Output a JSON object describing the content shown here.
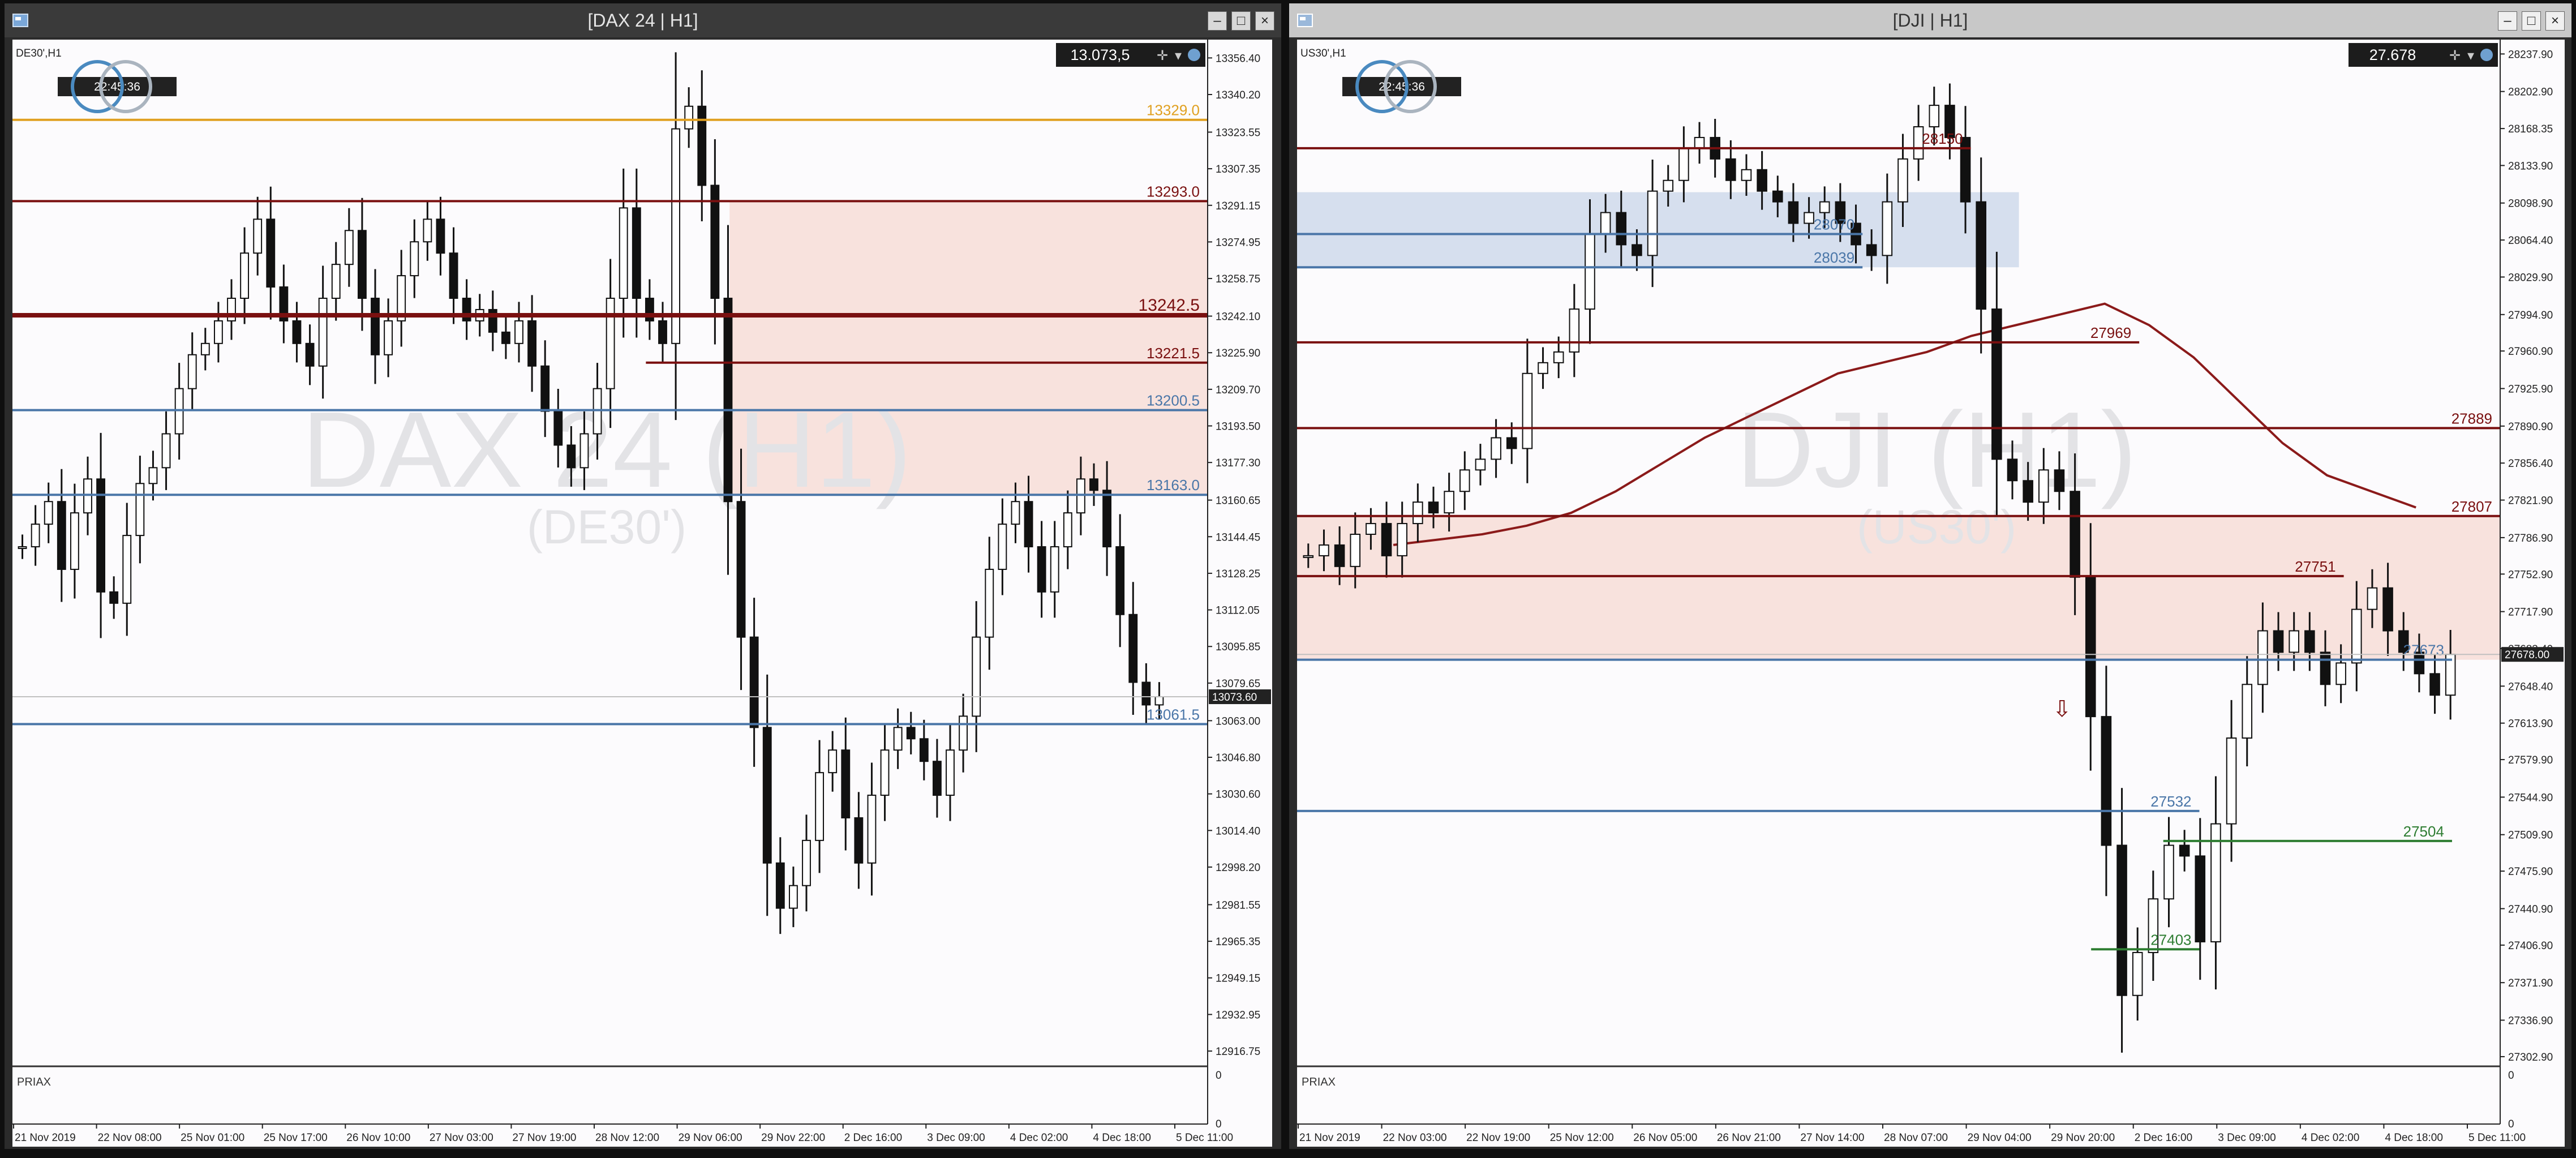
{
  "windows": [
    {
      "title": "[DAX 24 | H1]",
      "symbol_label": "DE30',H1",
      "clock": "22:45:36",
      "price_box": "13.073,5",
      "watermark_main": "DAX 24 (H1)",
      "watermark_sub": "(DE30')",
      "indicator_label": "PRIAX",
      "indicator_scale": [
        "0",
        "0"
      ],
      "current_price_tag": "13073.60"
    },
    {
      "title": "[DJI | H1]",
      "symbol_label": "US30',H1",
      "clock": "22:45:36",
      "price_box": "27.678",
      "watermark_main": "DJI (H1)",
      "watermark_sub": "(US30')",
      "indicator_label": "PRIAX",
      "indicator_scale": [
        "0",
        "0"
      ],
      "current_price_tag": "27678.00"
    }
  ],
  "colors": {
    "chart_bg": "#fcfbfd",
    "resistance": "#7a1010",
    "support": "#4a76a8",
    "support_green": "#2e7d32",
    "highlight_orange": "#e0a020",
    "zone_red": "#f7d9d2",
    "zone_blue": "#c9d6e8",
    "ma_line": "#8b1a1a"
  },
  "chart_data": [
    {
      "type": "candlestick",
      "symbol": "DAX 24 (DE30')",
      "timeframe": "H1",
      "y_ticks": [
        "13356.40",
        "13340.20",
        "13323.55",
        "13307.35",
        "13291.15",
        "13274.95",
        "13258.75",
        "13242.10",
        "13225.90",
        "13209.70",
        "13193.50",
        "13177.30",
        "13160.65",
        "13144.45",
        "13128.25",
        "13112.05",
        "13095.85",
        "13079.65",
        "13063.00",
        "13046.80",
        "13030.60",
        "13014.40",
        "12998.20",
        "12981.55",
        "12965.35",
        "12949.15",
        "12932.95",
        "12916.75"
      ],
      "ylim": [
        12911,
        13362
      ],
      "x_ticks": [
        "21 Nov 2019",
        "22 Nov 08:00",
        "25 Nov 01:00",
        "25 Nov 17:00",
        "26 Nov 10:00",
        "27 Nov 03:00",
        "27 Nov 19:00",
        "28 Nov 12:00",
        "29 Nov 06:00",
        "29 Nov 22:00",
        "2 Dec 16:00",
        "3 Dec 09:00",
        "4 Dec 02:00",
        "4 Dec 18:00",
        "5 Dec 11:00"
      ],
      "levels": [
        {
          "label": "13329.0",
          "value": 13329.0,
          "style": "orange",
          "x_from": 0.0
        },
        {
          "label": "13293.0",
          "value": 13293.0,
          "style": "resistance",
          "x_from": 0.0
        },
        {
          "label": "13242.5",
          "value": 13242.5,
          "style": "resistance_bold",
          "x_from": 0.0
        },
        {
          "label": "13221.5",
          "value": 13221.5,
          "style": "resistance",
          "x_from": 0.53
        },
        {
          "label": "13200.5",
          "value": 13200.5,
          "style": "support",
          "x_from": 0.0
        },
        {
          "label": "13163.0",
          "value": 13163.0,
          "style": "support",
          "x_from": 0.0
        },
        {
          "label": "13061.5",
          "value": 13061.5,
          "style": "support",
          "x_from": 0.0
        }
      ],
      "zones": [
        {
          "from": 13163.0,
          "to": 13293.0,
          "x_from": 0.6,
          "color": "red"
        }
      ],
      "current_price": 13073.6,
      "candles_close": [
        13140,
        13150,
        13160,
        13130,
        13155,
        13170,
        13120,
        13115,
        13145,
        13168,
        13175,
        13190,
        13210,
        13225,
        13230,
        13240,
        13250,
        13270,
        13285,
        13255,
        13240,
        13230,
        13220,
        13250,
        13265,
        13280,
        13250,
        13225,
        13240,
        13260,
        13275,
        13285,
        13270,
        13250,
        13240,
        13245,
        13235,
        13230,
        13240,
        13220,
        13200,
        13185,
        13175,
        13190,
        13210,
        13250,
        13290,
        13250,
        13240,
        13230,
        13325,
        13335,
        13300,
        13250,
        13160,
        13100,
        13060,
        13000,
        12980,
        12990,
        13010,
        13040,
        13050,
        13020,
        13000,
        13030,
        13050,
        13060,
        13055,
        13045,
        13030,
        13050,
        13065,
        13100,
        13130,
        13150,
        13160,
        13140,
        13120,
        13140,
        13155,
        13170,
        13165,
        13140,
        13110,
        13080,
        13070,
        13073.6
      ]
    },
    {
      "type": "candlestick",
      "symbol": "DJI (US30')",
      "timeframe": "H1",
      "y_ticks": [
        "28237.90",
        "28202.90",
        "28168.35",
        "28133.90",
        "28098.90",
        "28064.40",
        "28029.90",
        "27994.90",
        "27960.90",
        "27925.90",
        "27890.90",
        "27856.40",
        "27821.90",
        "27786.90",
        "27752.90",
        "27717.90",
        "27683.40",
        "27648.40",
        "27613.90",
        "27579.90",
        "27544.90",
        "27509.90",
        "27475.90",
        "27440.90",
        "27406.90",
        "27371.90",
        "27336.90",
        "27302.90"
      ],
      "ylim": [
        27296,
        28246
      ],
      "x_ticks": [
        "21 Nov 2019",
        "22 Nov 03:00",
        "22 Nov 19:00",
        "25 Nov 12:00",
        "26 Nov 05:00",
        "26 Nov 21:00",
        "27 Nov 14:00",
        "28 Nov 07:00",
        "29 Nov 04:00",
        "29 Nov 20:00",
        "2 Dec 16:00",
        "3 Dec 09:00",
        "4 Dec 02:00",
        "4 Dec 18:00",
        "5 Dec 11:00"
      ],
      "levels": [
        {
          "label": "28150",
          "value": 28150,
          "style": "resistance",
          "x_from": 0.0,
          "x_to": 0.56
        },
        {
          "label": "28070",
          "value": 28070,
          "style": "support",
          "x_from": 0.0,
          "x_to": 0.47
        },
        {
          "label": "28039",
          "value": 28039,
          "style": "support",
          "x_from": 0.0,
          "x_to": 0.47
        },
        {
          "label": "27969",
          "value": 27969,
          "style": "resistance",
          "x_from": 0.0,
          "x_to": 0.7
        },
        {
          "label": "27889",
          "value": 27889,
          "style": "resistance",
          "x_from": 0.0,
          "x_to": 1.0
        },
        {
          "label": "27807",
          "value": 27807,
          "style": "resistance",
          "x_from": 0.0,
          "x_to": 1.0
        },
        {
          "label": "27751",
          "value": 27751,
          "style": "resistance",
          "x_from": 0.0,
          "x_to": 0.87
        },
        {
          "label": "27673",
          "value": 27673,
          "style": "support",
          "x_from": 0.0,
          "x_to": 0.96
        },
        {
          "label": "27532",
          "value": 27532,
          "style": "support",
          "x_from": 0.0,
          "x_to": 0.75
        },
        {
          "label": "27504",
          "value": 27504,
          "style": "support_green",
          "x_from": 0.72,
          "x_to": 0.96
        },
        {
          "label": "27403",
          "value": 27403,
          "style": "support_green",
          "x_from": 0.66,
          "x_to": 0.75
        }
      ],
      "zones": [
        {
          "from": 28039,
          "to": 28109,
          "x_from": 0.0,
          "x_to": 0.6,
          "color": "blue"
        },
        {
          "from": 27673,
          "to": 27807,
          "x_from": 0.0,
          "x_to": 1.0,
          "color": "red"
        }
      ],
      "current_price": 27678.0,
      "ma_line": [
        27780,
        27785,
        27790,
        27798,
        27810,
        27830,
        27855,
        27880,
        27900,
        27920,
        27940,
        27950,
        27960,
        27975,
        27985,
        27995,
        28005,
        27985,
        27955,
        27915,
        27875,
        27845,
        27830,
        27815
      ],
      "candles_close": [
        27770,
        27780,
        27760,
        27790,
        27800,
        27770,
        27800,
        27820,
        27810,
        27830,
        27850,
        27860,
        27880,
        27870,
        27940,
        27950,
        27960,
        28000,
        28070,
        28090,
        28060,
        28050,
        28110,
        28120,
        28150,
        28160,
        28140,
        28120,
        28130,
        28110,
        28100,
        28080,
        28090,
        28100,
        28080,
        28060,
        28050,
        28100,
        28140,
        28170,
        28190,
        28160,
        28100,
        28000,
        27860,
        27840,
        27820,
        27850,
        27830,
        27750,
        27620,
        27500,
        27360,
        27400,
        27450,
        27500,
        27490,
        27410,
        27520,
        27600,
        27650,
        27700,
        27680,
        27700,
        27680,
        27650,
        27670,
        27720,
        27740,
        27700,
        27680,
        27660,
        27640,
        27678
      ]
    }
  ]
}
